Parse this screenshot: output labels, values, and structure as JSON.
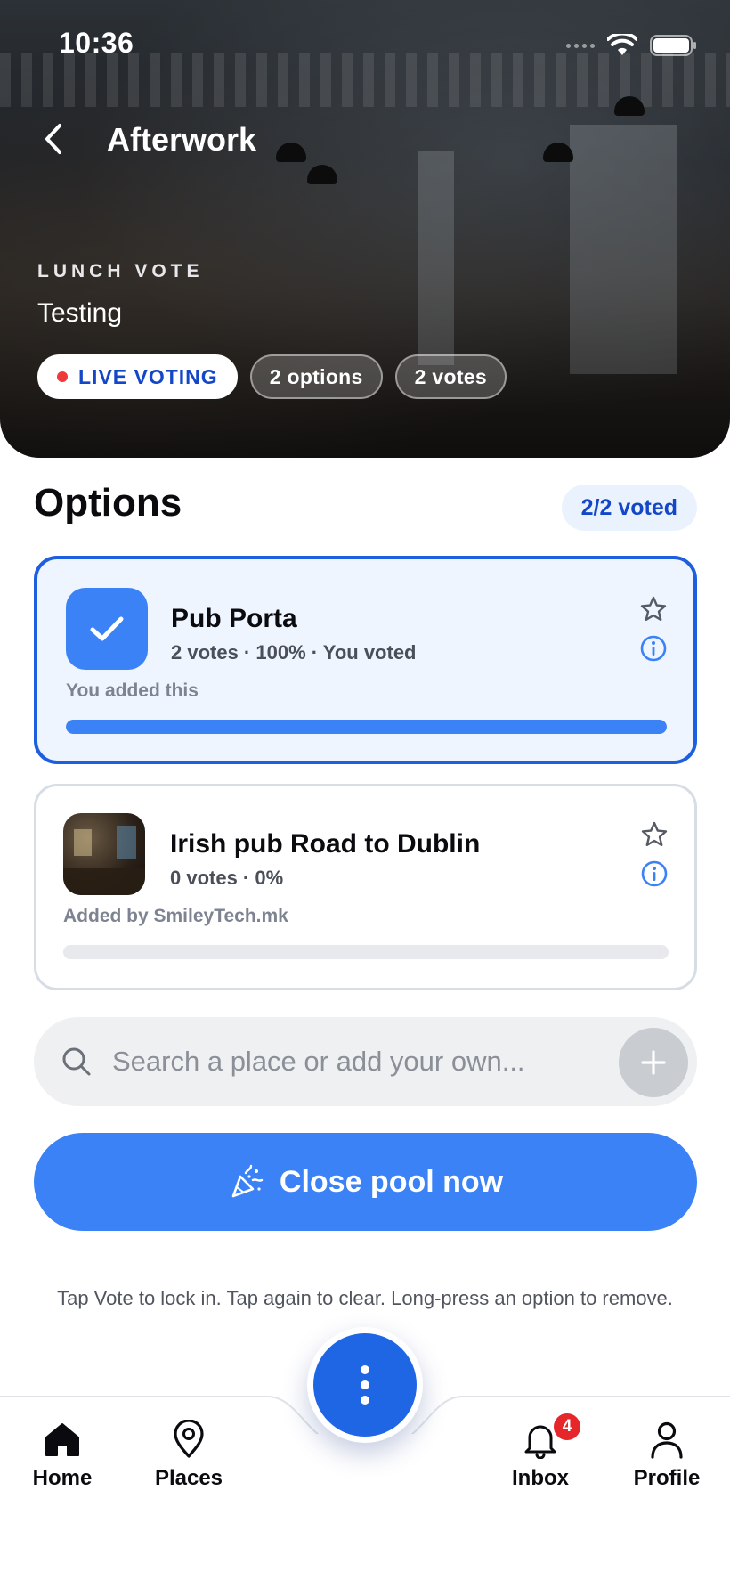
{
  "status_bar": {
    "time": "10:36"
  },
  "header": {
    "title": "Afterwork"
  },
  "hero": {
    "eyebrow": "LUNCH VOTE",
    "subtitle": "Testing",
    "chips": {
      "live": "LIVE VOTING",
      "options": "2 options",
      "votes": "2 votes"
    }
  },
  "options": {
    "heading": "Options",
    "voted_pill": "2/2 voted",
    "items": [
      {
        "name": "Pub Porta",
        "meta": "2 votes · 100% · You voted",
        "added": "You added this",
        "share": 1.0,
        "selected": true
      },
      {
        "name": "Irish pub Road to Dublin",
        "meta": "0 votes · 0%",
        "added": "Added by SmileyTech.mk",
        "share": 0.0,
        "selected": false
      }
    ]
  },
  "search": {
    "placeholder": "Search a place or add your own..."
  },
  "close_button": {
    "label": "Close pool now"
  },
  "hint": {
    "text": "Tap Vote to lock in. Tap again to clear. Long-press an option to remove."
  },
  "tabbar": {
    "home": "Home",
    "places": "Places",
    "inbox": "Inbox",
    "inbox_badge": "4",
    "profile": "Profile"
  },
  "colors": {
    "accent": "#3b82f6",
    "accent_dark": "#1447c7",
    "live_dot": "#ef3a3a",
    "badge": "#e5262b"
  }
}
